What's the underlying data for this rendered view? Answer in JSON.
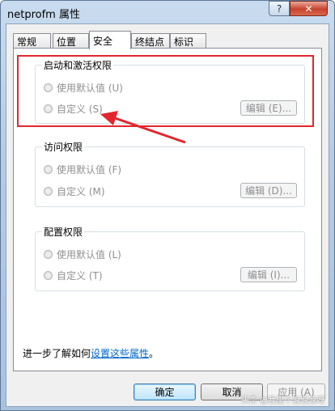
{
  "window": {
    "title": "netprofm 属性"
  },
  "titlebar": {
    "help_label": "?",
    "close_label": "✕"
  },
  "tabs": [
    {
      "label": "常规"
    },
    {
      "label": "位置"
    },
    {
      "label": "安全"
    },
    {
      "label": "终结点"
    },
    {
      "label": "标识"
    }
  ],
  "active_tab_index": 2,
  "groups": {
    "launch": {
      "title": "启动和激活权限",
      "default_option": "使用默认值 (U)",
      "custom_option": "自定义 (S)",
      "edit_label": "编辑 (E)..."
    },
    "access": {
      "title": "访问权限",
      "default_option": "使用默认值 (F)",
      "custom_option": "自定义 (M)",
      "edit_label": "编辑 (D)..."
    },
    "config": {
      "title": "配置权限",
      "default_option": "使用默认值 (L)",
      "custom_option": "自定义 (T)",
      "edit_label": "编辑 (I)..."
    }
  },
  "learn_more": {
    "prefix": "进一步了解如何",
    "link": "设置这些属性",
    "suffix": "。"
  },
  "buttons": {
    "ok": "确定",
    "cancel": "取消",
    "apply": "应用 (A)"
  },
  "watermark": "头条 @我里个浪浪浪呀",
  "colors": {
    "annotation_red": "#e2262d",
    "link_blue": "#0066cc"
  }
}
